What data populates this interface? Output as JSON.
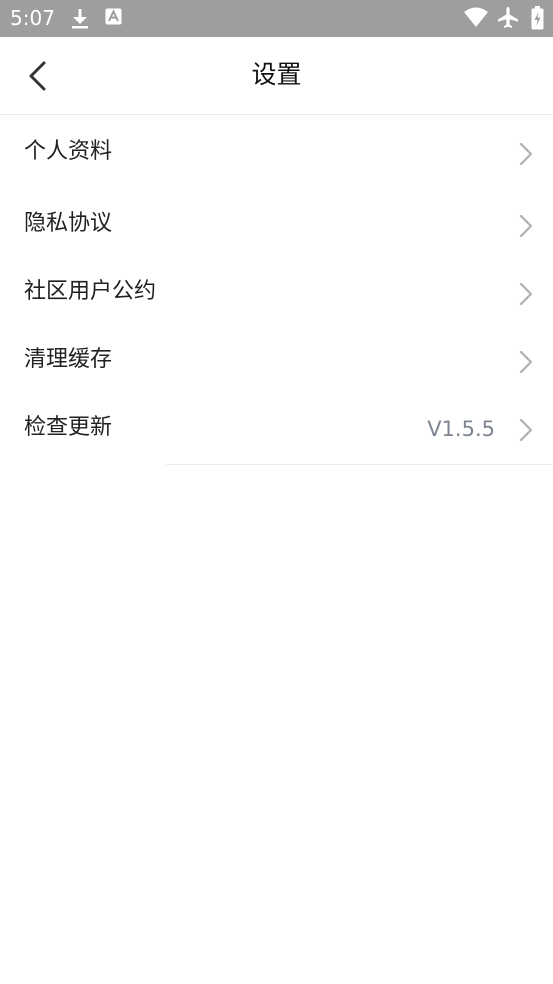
{
  "status_bar": {
    "time": "5:07",
    "icons": [
      "download-icon",
      "font-a-icon",
      "wifi-icon",
      "airplane-icon",
      "battery-icon"
    ],
    "background": "#9e9e9e"
  },
  "header": {
    "title": "设置",
    "back_icon": "chevron-left-icon"
  },
  "menu": {
    "items": [
      {
        "label": "个人资料"
      },
      {
        "label": "隐私协议"
      },
      {
        "label": "社区用户公约"
      },
      {
        "label": "清理缓存"
      },
      {
        "label": "检查更新",
        "value": "V1.5.5"
      }
    ]
  },
  "colors": {
    "text_primary": "#222222",
    "text_secondary": "#7e8593",
    "chevron": "#b0b0b0",
    "divider": "#ececec"
  }
}
